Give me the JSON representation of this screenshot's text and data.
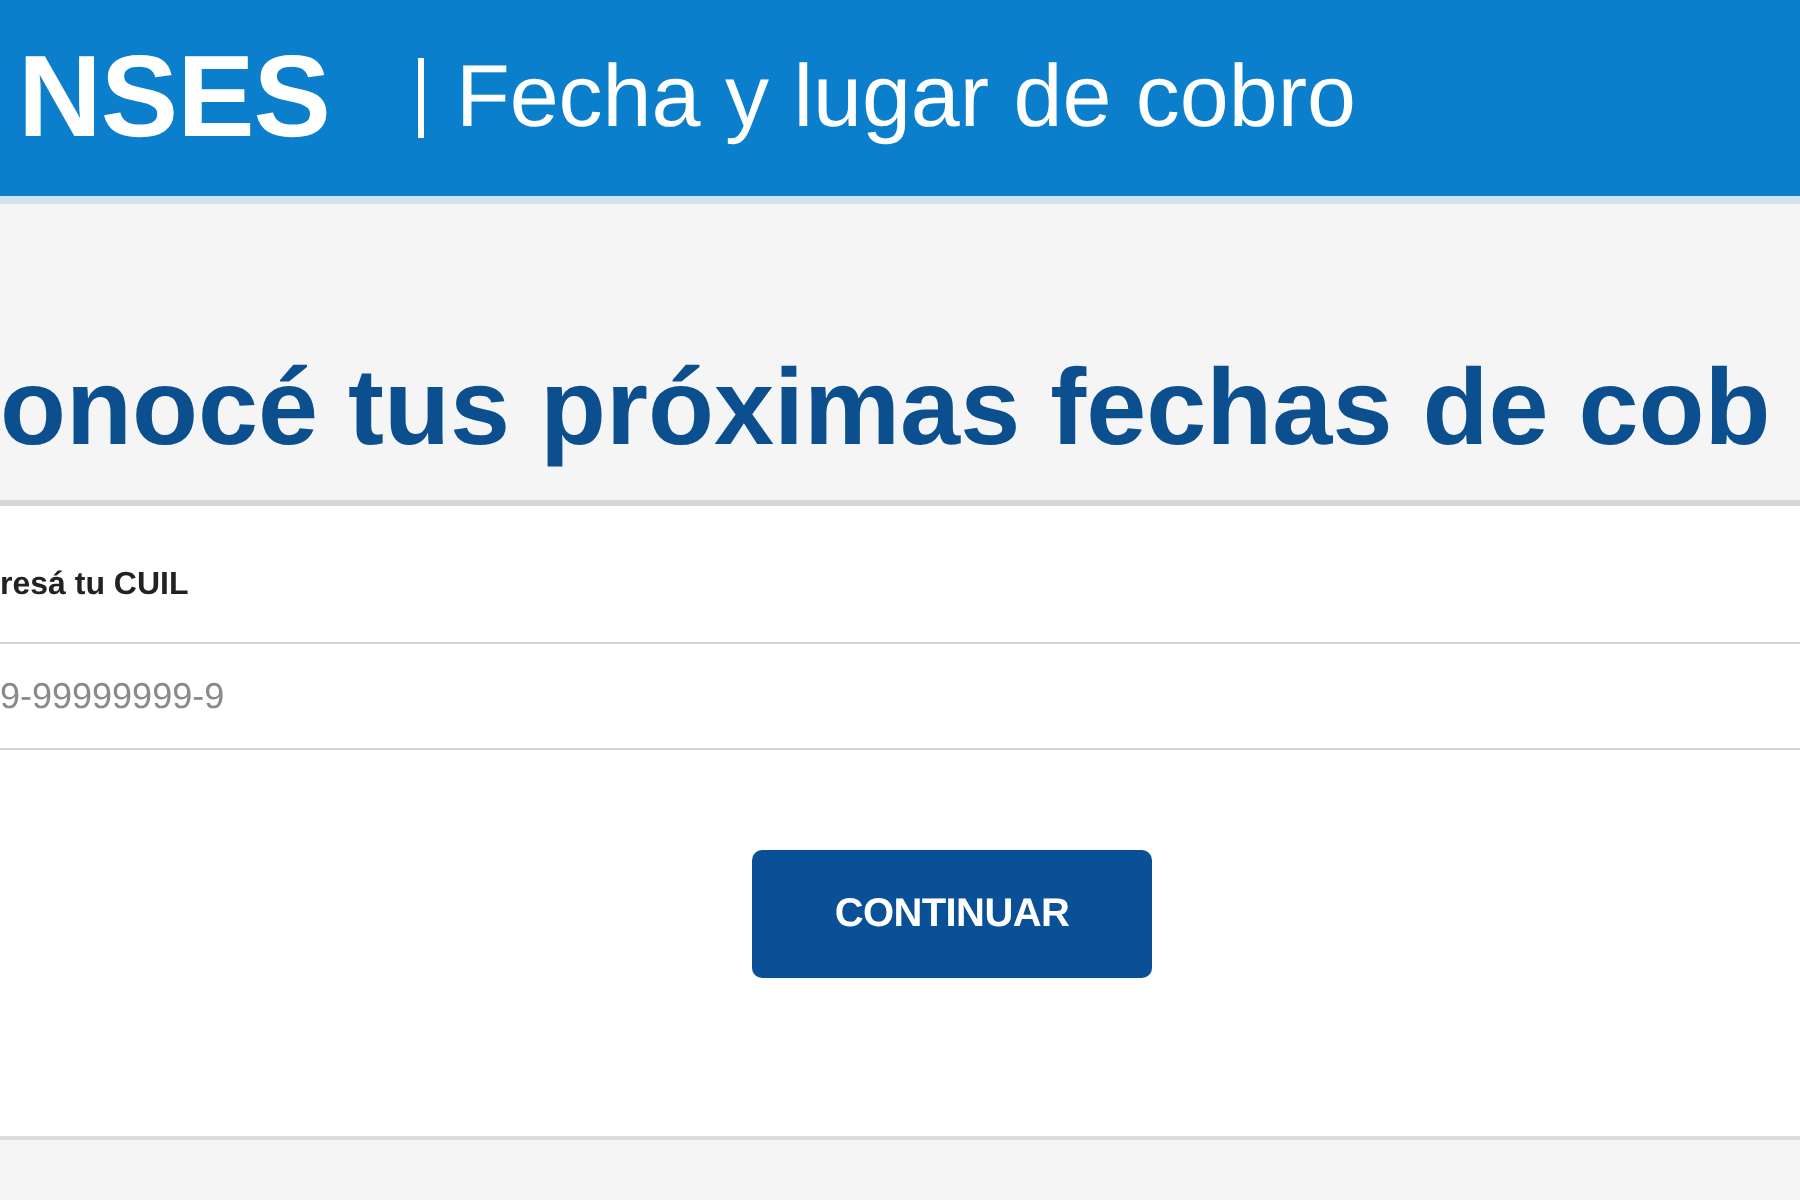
{
  "header": {
    "logo": "NSES",
    "title": "Fecha y lugar de cobro"
  },
  "heading": "onocé tus próximas fechas de cob",
  "form": {
    "label": "resá tu CUIL",
    "cuil_field": {
      "placeholder": "9-99999999-9"
    },
    "button": "CONTINUAR"
  }
}
